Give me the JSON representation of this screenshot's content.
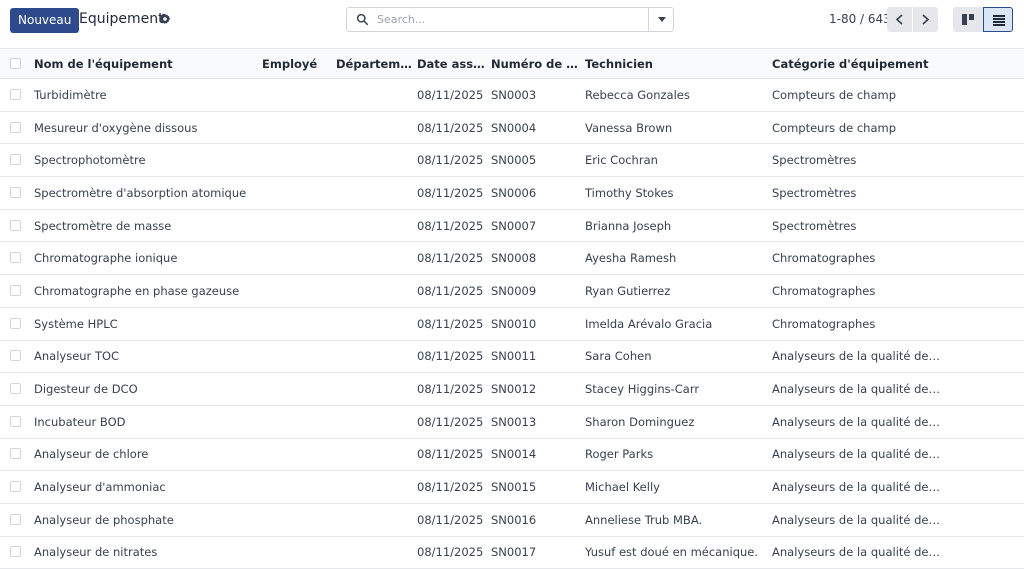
{
  "toolbar": {
    "new_label": "Nouveau",
    "title": "Equipement",
    "settings_icon": "gear-icon"
  },
  "search": {
    "placeholder": "Search...",
    "icon": "search-icon",
    "toggle_icon": "caret-down-icon"
  },
  "pager": {
    "range": "1-80 / 643",
    "prev_icon": "chevron-left-icon",
    "next_icon": "chevron-right-icon"
  },
  "views": {
    "kanban_icon": "kanban-view-icon",
    "list_icon": "list-view-icon",
    "active": "list"
  },
  "colors": {
    "primary": "#2d4a8d",
    "row_border": "#e5e7eb"
  },
  "table": {
    "headers": {
      "name": "Nom de l'équipement",
      "employee": "Employé",
      "department": "Département",
      "date": "Date assi…",
      "serial": "Numéro de sé…",
      "technician": "Technicien",
      "category": "Catégorie d'équipement"
    },
    "rows": [
      {
        "name": "Turbidimètre",
        "employee": "",
        "department": "",
        "date": "08/11/2025",
        "serial": "SN0003",
        "technician": "Rebecca Gonzales",
        "category": "Compteurs de champ"
      },
      {
        "name": "Mesureur d'oxygène dissous",
        "employee": "",
        "department": "",
        "date": "08/11/2025",
        "serial": "SN0004",
        "technician": "Vanessa Brown",
        "category": "Compteurs de champ"
      },
      {
        "name": "Spectrophotomètre",
        "employee": "",
        "department": "",
        "date": "08/11/2025",
        "serial": "SN0005",
        "technician": "Eric Cochran",
        "category": "Spectromètres"
      },
      {
        "name": "Spectromètre d'absorption atomique",
        "employee": "",
        "department": "",
        "date": "08/11/2025",
        "serial": "SN0006",
        "technician": "Timothy Stokes",
        "category": "Spectromètres"
      },
      {
        "name": "Spectromètre de masse",
        "employee": "",
        "department": "",
        "date": "08/11/2025",
        "serial": "SN0007",
        "technician": "Brianna Joseph",
        "category": "Spectromètres"
      },
      {
        "name": "Chromatographe ionique",
        "employee": "",
        "department": "",
        "date": "08/11/2025",
        "serial": "SN0008",
        "technician": "Ayesha Ramesh",
        "category": "Chromatographes"
      },
      {
        "name": "Chromatographe en phase gazeuse",
        "employee": "",
        "department": "",
        "date": "08/11/2025",
        "serial": "SN0009",
        "technician": "Ryan Gutierrez",
        "category": "Chromatographes"
      },
      {
        "name": "Système HPLC",
        "employee": "",
        "department": "",
        "date": "08/11/2025",
        "serial": "SN0010",
        "technician": "Imelda Arévalo Gracia",
        "category": "Chromatographes"
      },
      {
        "name": "Analyseur TOC",
        "employee": "",
        "department": "",
        "date": "08/11/2025",
        "serial": "SN0011",
        "technician": "Sara Cohen",
        "category": "Analyseurs de la qualité de l'e…"
      },
      {
        "name": "Digesteur de DCO",
        "employee": "",
        "department": "",
        "date": "08/11/2025",
        "serial": "SN0012",
        "technician": "Stacey Higgins-Carr",
        "category": "Analyseurs de la qualité de l'e…"
      },
      {
        "name": "Incubateur BOD",
        "employee": "",
        "department": "",
        "date": "08/11/2025",
        "serial": "SN0013",
        "technician": "Sharon Dominguez",
        "category": "Analyseurs de la qualité de l'e…"
      },
      {
        "name": "Analyseur de chlore",
        "employee": "",
        "department": "",
        "date": "08/11/2025",
        "serial": "SN0014",
        "technician": "Roger Parks",
        "category": "Analyseurs de la qualité de l'e…"
      },
      {
        "name": "Analyseur d'ammoniac",
        "employee": "",
        "department": "",
        "date": "08/11/2025",
        "serial": "SN0015",
        "technician": "Michael Kelly",
        "category": "Analyseurs de la qualité de l'e…"
      },
      {
        "name": "Analyseur de phosphate",
        "employee": "",
        "department": "",
        "date": "08/11/2025",
        "serial": "SN0016",
        "technician": "Anneliese Trub MBA.",
        "category": "Analyseurs de la qualité de l'e…"
      },
      {
        "name": "Analyseur de nitrates",
        "employee": "",
        "department": "",
        "date": "08/11/2025",
        "serial": "SN0017",
        "technician": "Yusuf est doué en mécanique.",
        "category": "Analyseurs de la qualité de l'e…"
      }
    ]
  }
}
